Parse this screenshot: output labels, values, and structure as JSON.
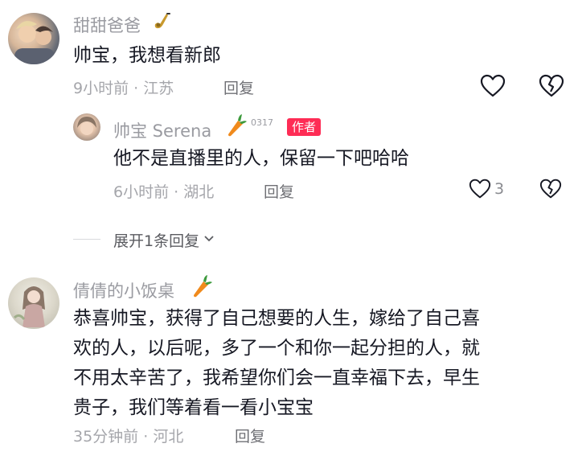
{
  "comments": [
    {
      "username": "甜甜爸爸",
      "text": "帅宝，我想看新郎",
      "time": "9小时前",
      "location": "江苏",
      "reply_label": "回复",
      "badge_icon": "saxophone-icon",
      "replies": [
        {
          "username": "帅宝 Serena",
          "badge_icon": "carrot-icon",
          "level": "0317",
          "author_tag": "作者",
          "text": "他不是直播里的人，保留一下吧哈哈",
          "time": "6小时前",
          "location": "湖北",
          "reply_label": "回复",
          "like_count": "3"
        }
      ],
      "expand_label": "展开1条回复"
    },
    {
      "username": "倩倩的小饭桌",
      "badge_icon": "carrot-icon",
      "text_lines": [
        "恭喜帅宝，获得了自己想要的人生，嫁给了自己喜",
        "欢的人，以后呢，多了一个和你一起分担的人，就",
        "不用太辛苦了，我希望你们会一直幸福下去，早生",
        "贵子，我们等着看一看小宝宝"
      ],
      "time": "35分钟前",
      "location": "河北",
      "reply_label": "回复"
    }
  ],
  "separator": "·",
  "colors": {
    "author_badge": "#fe2c55",
    "meta": "#a5a6ab",
    "text": "#161823"
  }
}
